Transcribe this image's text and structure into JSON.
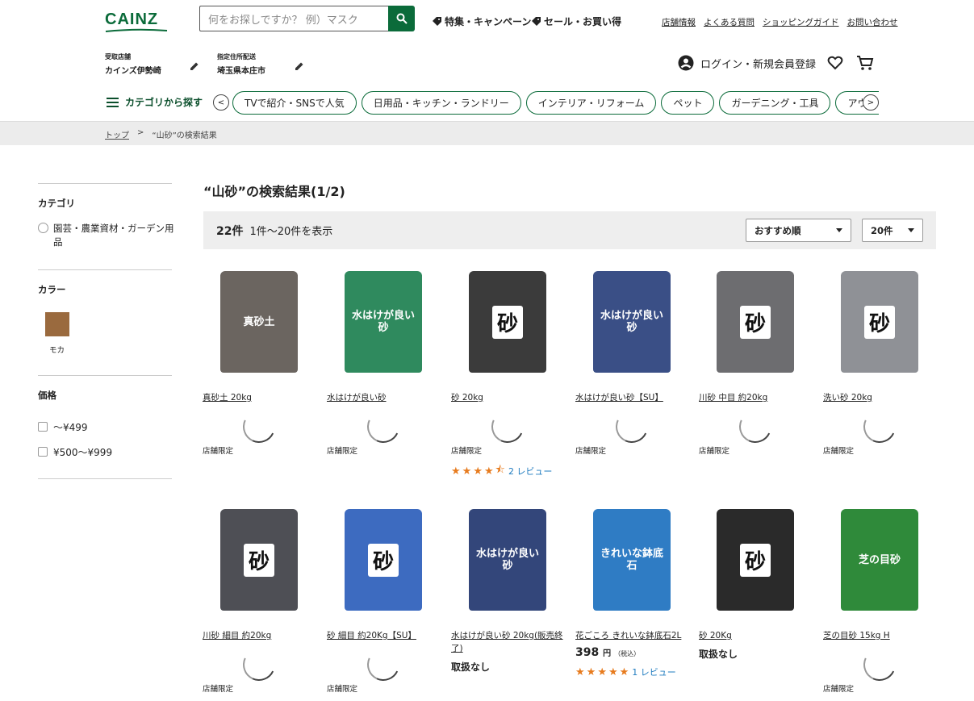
{
  "header": {
    "logo": "CAINZ",
    "search_placeholder": "何をお探しですか？ 例）マスク",
    "promos": [
      "特集・キャンペーン",
      "セール・お買い得"
    ],
    "util_links": [
      "店舗情報",
      "よくある質問",
      "ショッピングガイド",
      "お問い合わせ"
    ],
    "pickup_label": "受取店舗",
    "pickup_value": "カインズ伊勢崎",
    "delivery_label": "指定住所配送",
    "delivery_value": "埼玉県本庄市",
    "login_label": "ログイン・新規会員登録"
  },
  "nav": {
    "category_menu": "カテゴリから探す",
    "prev": "<",
    "next": ">",
    "chips": [
      "TVで紹介・SNSで人気",
      "日用品・キッチン・ランドリー",
      "インテリア・リフォーム",
      "ペット",
      "ガーデニング・工具",
      "アウトドア・カー用品"
    ]
  },
  "breadcrumb": {
    "home": "トップ",
    "sep": ">",
    "current": "“山砂”の検索結果"
  },
  "sidebar": {
    "category_title": "カテゴリ",
    "category_option": "園芸・農業資材・ガーデン用品",
    "color_title": "カラー",
    "color_name": "モカ",
    "color_hex": "#9a6a3e",
    "price_title": "価格",
    "price_options": [
      "〜¥499",
      "¥500〜¥999"
    ]
  },
  "main": {
    "title": "“山砂”の検索結果(1/2)",
    "count": "22件",
    "range": "1件〜20件を表示",
    "sort": "おすすめ順",
    "per_page": "20件"
  },
  "products": [
    {
      "name": "真砂土 20kg",
      "status": "店舗限定",
      "bag_text": "真砂土",
      "bag_color": "#6b6560"
    },
    {
      "name": "水はけが良い砂",
      "status": "店舗限定",
      "bag_text": "水はけが良い砂",
      "bag_color": "#2f8a5e"
    },
    {
      "name": "砂 20kg",
      "status": "店舗限定",
      "bag_text": "砂",
      "bag_color": "#3b3b3b",
      "rating": 4.5,
      "reviews": "2 レビュー"
    },
    {
      "name": "水はけが良い砂【SU】",
      "status": "店舗限定",
      "bag_text": "水はけが良い砂",
      "bag_color": "#3a4f86"
    },
    {
      "name": "川砂 中目 約20kg",
      "status": "店舗限定",
      "bag_text": "砂",
      "bag_color": "#6d6d70"
    },
    {
      "name": "洗い砂 20kg",
      "status": "店舗限定",
      "bag_text": "砂",
      "bag_color": "#8f9196"
    },
    {
      "name": "川砂 細目 約20kg",
      "status": "店舗限定",
      "bag_text": "砂",
      "bag_color": "#4e4f55"
    },
    {
      "name": "砂 細目 約20Kg【SU】",
      "status": "店舗限定",
      "bag_text": "砂",
      "bag_color": "#3d6bc0"
    },
    {
      "name": "水はけが良い砂 20kg(販売終了)",
      "status": "取扱なし",
      "bag_text": "水はけが良い砂",
      "bag_color": "#33467a"
    },
    {
      "name": "花ごころ きれいな鉢底石2L",
      "price": "398",
      "yen": "円",
      "tax": "（税込）",
      "bag_text": "きれいな鉢底石",
      "bag_color": "#2f7cc4",
      "rating": 5,
      "reviews": "1 レビュー"
    },
    {
      "name": "砂 20Kg",
      "status": "取扱なし",
      "bag_text": "砂",
      "bag_color": "#2a2a2a"
    },
    {
      "name": "芝の目砂 15kg H",
      "status": "店舗限定",
      "bag_text": "芝の目砂",
      "bag_color": "#2f8a3a"
    }
  ]
}
